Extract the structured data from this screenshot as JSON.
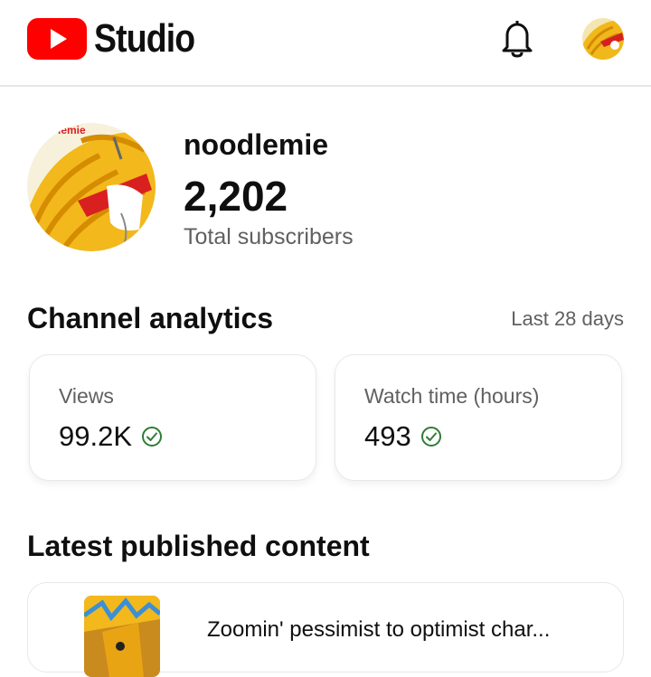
{
  "app": {
    "logo_text": "Studio",
    "brand_color": "#ff0000"
  },
  "header": {
    "notification_icon": "bell-icon",
    "avatar_icon": "avatar"
  },
  "channel": {
    "name": "noodlemie",
    "subscriber_count": "2,202",
    "subscriber_label": "Total subscribers",
    "avatar_text": "lemie"
  },
  "analytics": {
    "title": "Channel analytics",
    "period": "Last 28 days",
    "metrics": [
      {
        "label": "Views",
        "value": "99.2K",
        "status_icon": "check-circle-icon",
        "status_color": "#2e7d32"
      },
      {
        "label": "Watch time (hours)",
        "value": "493",
        "status_icon": "check-circle-icon",
        "status_color": "#2e7d32"
      }
    ]
  },
  "latest": {
    "title": "Latest published content",
    "items": [
      {
        "title": "Zoomin' pessimist to optimist char..."
      }
    ]
  }
}
